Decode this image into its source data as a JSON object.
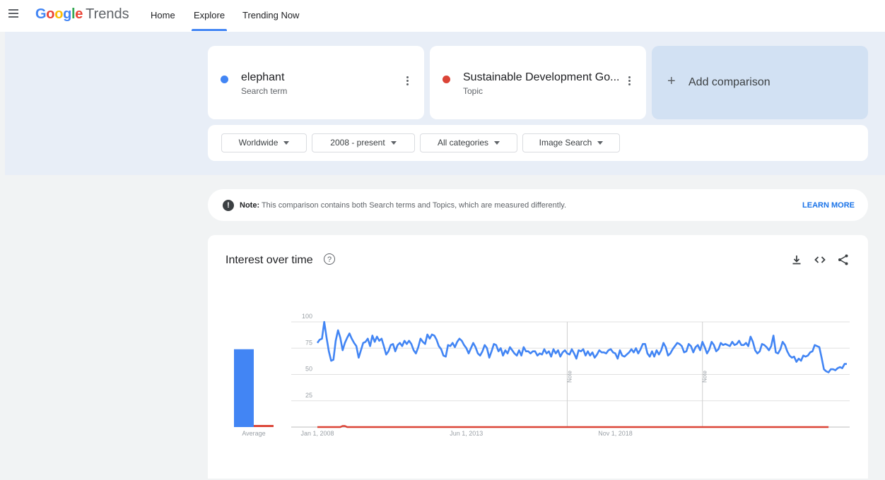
{
  "header": {
    "logo_google": "Google",
    "logo_trends": "Trends",
    "nav": [
      "Home",
      "Explore",
      "Trending Now"
    ],
    "active_nav": "Explore"
  },
  "terms": [
    {
      "name": "elephant",
      "type": "Search term",
      "color": "#4285f4"
    },
    {
      "name": "Sustainable Development Go...",
      "type": "Topic",
      "color": "#db4437"
    }
  ],
  "add_comparison": {
    "plus": "+",
    "label": "Add comparison"
  },
  "filters": [
    "Worldwide",
    "2008 - present",
    "All categories",
    "Image Search"
  ],
  "note": {
    "icon": "!",
    "bold": "Note:",
    "text": " This comparison contains both Search terms and Topics, which are measured differently.",
    "link": "LEARN MORE"
  },
  "chart": {
    "title": "Interest over time",
    "help_icon": "?",
    "actions": [
      "download-icon",
      "embed-icon",
      "share-icon"
    ]
  },
  "chart_data": {
    "type": "line",
    "y_ticks": [
      100,
      75,
      50,
      25
    ],
    "ylim": [
      0,
      100
    ],
    "x_ticks": [
      "Jan 1, 2008",
      "Jun 1, 2013",
      "Nov 1, 2018"
    ],
    "x_tick_index": [
      0,
      65,
      130
    ],
    "note_markers": [
      {
        "label": "Note",
        "index": 109
      },
      {
        "label": "Note",
        "index": 168
      }
    ],
    "average": {
      "label": "Average",
      "values": [
        74,
        2
      ]
    },
    "series": [
      {
        "name": "elephant",
        "color": "#4285f4",
        "values": [
          80,
          83,
          84,
          100,
          85,
          72,
          63,
          64,
          82,
          92,
          85,
          73,
          80,
          85,
          89,
          84,
          80,
          77,
          66,
          73,
          80,
          81,
          84,
          77,
          87,
          81,
          86,
          82,
          84,
          77,
          69,
          72,
          78,
          79,
          72,
          78,
          80,
          77,
          82,
          79,
          82,
          79,
          73,
          70,
          76,
          84,
          81,
          79,
          88,
          84,
          88,
          87,
          83,
          77,
          74,
          68,
          67,
          78,
          77,
          80,
          76,
          81,
          84,
          82,
          78,
          75,
          70,
          75,
          80,
          76,
          70,
          68,
          72,
          78,
          75,
          66,
          72,
          79,
          78,
          72,
          75,
          68,
          73,
          70,
          76,
          73,
          70,
          68,
          73,
          68,
          76,
          72,
          72,
          70,
          72,
          72,
          68,
          70,
          69,
          74,
          70,
          72,
          67,
          74,
          70,
          73,
          67,
          71,
          73,
          70,
          69,
          74,
          70,
          65,
          73,
          72,
          74,
          68,
          72,
          68,
          71,
          66,
          69,
          73,
          71,
          71,
          70,
          73,
          74,
          71,
          70,
          65,
          73,
          68,
          67,
          69,
          71,
          74,
          71,
          75,
          70,
          74,
          79,
          79,
          70,
          67,
          72,
          67,
          73,
          69,
          73,
          80,
          76,
          68,
          70,
          74,
          77,
          80,
          79,
          77,
          71,
          72,
          79,
          77,
          71,
          76,
          78,
          73,
          81,
          76,
          70,
          74,
          81,
          78,
          72,
          74,
          80,
          78,
          79,
          78,
          77,
          81,
          78,
          79,
          82,
          78,
          78,
          80,
          77,
          86,
          81,
          73,
          70,
          72,
          79,
          78,
          76,
          73,
          77,
          87,
          71,
          70,
          74,
          81,
          78,
          72,
          68,
          66,
          67,
          62,
          65,
          63,
          68,
          67,
          68,
          71,
          72,
          78,
          77,
          76,
          66,
          55,
          53,
          52,
          55,
          55,
          54,
          56,
          57,
          56,
          60,
          60
        ]
      },
      {
        "name": "Sustainable Development Go...",
        "color": "#db4437",
        "values": [
          0,
          0,
          0,
          0,
          0,
          0,
          0,
          0,
          0,
          0,
          0,
          1,
          1,
          0,
          0,
          0,
          0,
          0,
          0,
          0,
          0,
          0,
          0,
          0,
          0,
          0,
          0,
          0,
          0,
          0,
          0,
          0,
          0,
          0,
          0,
          0,
          0,
          0,
          0,
          0,
          0,
          0,
          0,
          0,
          0,
          0,
          0,
          0,
          0,
          0,
          0,
          0,
          0,
          0,
          0,
          0,
          0,
          0,
          0,
          0,
          0,
          0,
          0,
          0,
          0,
          0,
          0,
          0,
          0,
          0,
          0,
          0,
          0,
          0,
          0,
          0,
          0,
          0,
          0,
          0,
          0,
          0,
          0,
          0,
          0,
          0,
          0,
          0,
          0,
          0,
          0,
          0,
          0,
          0,
          0,
          0,
          0,
          0,
          0,
          0,
          0,
          0,
          0,
          0,
          0,
          0,
          0,
          0,
          0,
          0,
          0,
          0,
          0,
          0,
          0,
          0,
          0,
          0,
          0,
          0,
          0,
          0,
          0,
          0,
          0,
          0,
          0,
          0,
          0,
          0,
          0,
          0,
          0,
          0,
          0,
          0,
          0,
          0,
          0,
          0,
          0,
          0,
          0,
          0,
          0,
          0,
          0,
          0,
          0,
          0,
          0,
          0,
          0,
          0,
          0,
          0,
          0,
          0,
          0,
          0,
          0,
          0,
          0,
          0,
          0,
          0,
          0,
          0,
          0,
          0,
          0,
          0,
          0,
          0,
          0,
          0,
          0,
          0,
          0,
          0,
          0,
          0,
          0,
          0,
          0,
          0,
          0,
          0,
          0,
          0,
          0,
          0,
          0,
          0,
          0,
          0,
          0,
          0,
          0,
          0,
          0,
          0,
          0,
          0,
          0,
          0,
          0,
          0,
          0,
          0,
          0,
          0,
          0,
          0,
          0,
          0,
          0,
          0,
          0,
          0,
          0,
          0,
          0,
          0
        ]
      }
    ]
  }
}
